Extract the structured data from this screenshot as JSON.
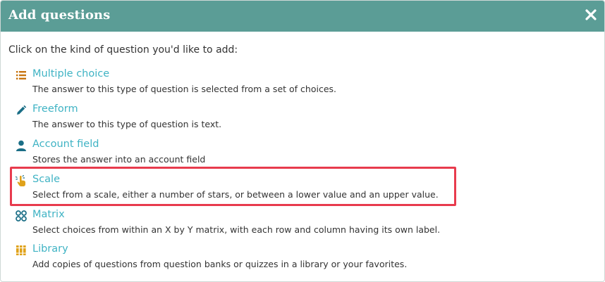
{
  "dialog": {
    "title": "Add questions",
    "close_icon": "close-icon",
    "intro": "Click on the kind of question you'd like to add:"
  },
  "questions": [
    {
      "label": "Multiple choice",
      "description": "The answer to this type of question is selected from a set of choices.",
      "icon": "list-icon",
      "icon_color": "#c8740e"
    },
    {
      "label": "Freeform",
      "description": "The answer to this type of question is text.",
      "icon": "pencil-icon",
      "icon_color": "#1a6e86"
    },
    {
      "label": "Account field",
      "description": "Stores the answer into an account field",
      "icon": "user-icon",
      "icon_color": "#1a6e86"
    },
    {
      "label": "Scale",
      "description": "Select from a scale, either a number of stars, or between a lower value and an upper value.",
      "icon": "scale-hand-icon",
      "icon_color": "#e0a21a",
      "highlighted": true
    },
    {
      "label": "Matrix",
      "description": "Select choices from within an X by Y matrix, with each row and column having its own label.",
      "icon": "matrix-icon",
      "icon_color": "#1a6e86"
    },
    {
      "label": "Library",
      "description": "Add copies of questions from question banks or quizzes in a library or your favorites.",
      "icon": "library-icon",
      "icon_color": "#e0a21a"
    }
  ],
  "colors": {
    "header_bg": "#5b9d96",
    "link": "#3fb3c4",
    "highlight_border": "#e83b4d"
  }
}
